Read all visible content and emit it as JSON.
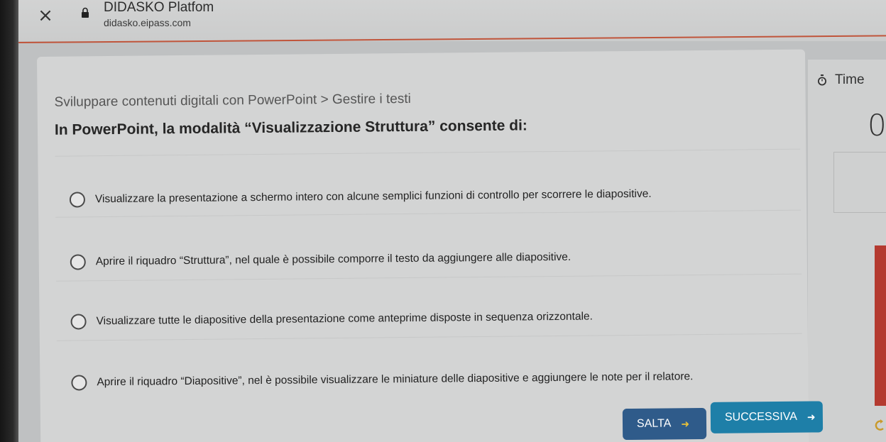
{
  "browser": {
    "title": "DIDASKO Platfom",
    "url": "didasko.eipass.com",
    "close_glyph": "×",
    "lock_icon": "lock-icon"
  },
  "quiz": {
    "breadcrumb": "Sviluppare contenuti digitali con PowerPoint > Gestire i testi",
    "question": "In PowerPoint, la modalità “Visualizzazione Struttura” consente di:",
    "options": [
      {
        "text": "Visualizzare la presentazione a schermo intero con alcune semplici funzioni di controllo per scorrere le diapositive."
      },
      {
        "text": "Aprire il riquadro “Struttura”, nel quale è possibile comporre il testo da aggiungere alle diapositive."
      },
      {
        "text": "Visualizzare tutte le diapositive della presentazione come anteprime disposte in sequenza orizzontale."
      },
      {
        "text": "Aprire il riquadro “Diapositive”, nel è possibile visualizzare le miniature delle diapositive e aggiungere le note per il relatore."
      }
    ],
    "skip_label": "SALTA",
    "next_label": "SUCCESSIVA",
    "arrow_glyph": "➜"
  },
  "timer": {
    "label": "Time",
    "value": "0",
    "icon": "stopwatch-icon"
  },
  "colors": {
    "progress": "#c0553b",
    "skip_button": "#2f5b8a",
    "next_button": "#1e7fa8",
    "accent_red": "#b43a30"
  }
}
